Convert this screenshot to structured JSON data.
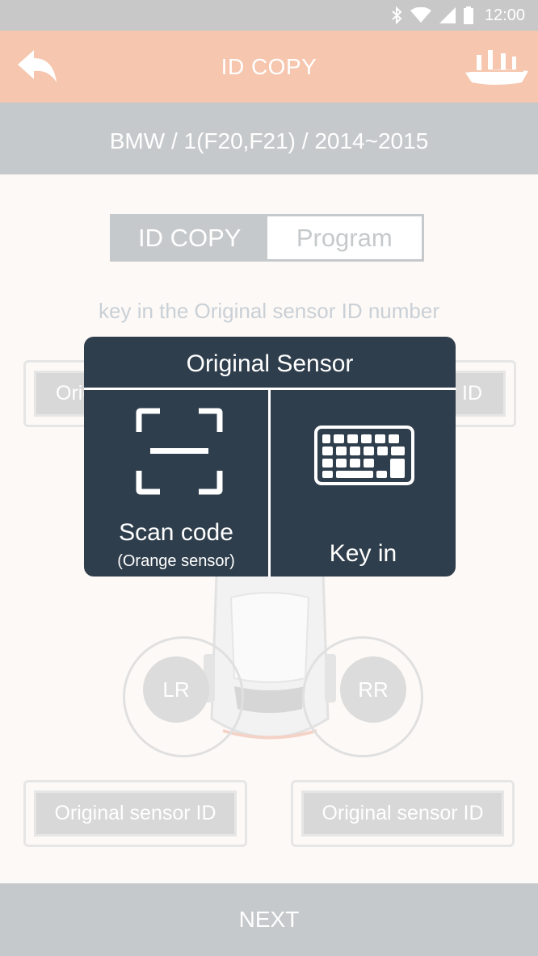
{
  "status_bar": {
    "time": "12:00",
    "icons": [
      "bluetooth-icon",
      "wifi-icon",
      "signal-icon",
      "battery-icon"
    ]
  },
  "app_bar": {
    "title": "ID COPY",
    "back_icon": "back-arrow-icon",
    "logo": "ship-logo-icon"
  },
  "vehicle_line": "BMW / 1(F20,F21) / 2014~2015",
  "tabs": {
    "active": "ID COPY",
    "inactive": "Program"
  },
  "instruction": "key in the Original sensor ID number",
  "sensors": {
    "lf_label": "Original sensor ID",
    "rf_label": "Original sensor ID",
    "lr_label": "Original sensor ID",
    "rr_label": "Original sensor ID",
    "lr_wheel": "LR",
    "rr_wheel": "RR"
  },
  "dialog": {
    "title": "Original Sensor",
    "scan_label": "Scan code",
    "scan_sub": "(Orange sensor)",
    "key_label": "Key in"
  },
  "footer": {
    "next_label": "NEXT"
  },
  "colors": {
    "app_bar": "#f6c6ae",
    "gray_bar": "#c6c9cb",
    "dialog": "#2f3e4c",
    "background": "#fdf9f6"
  }
}
